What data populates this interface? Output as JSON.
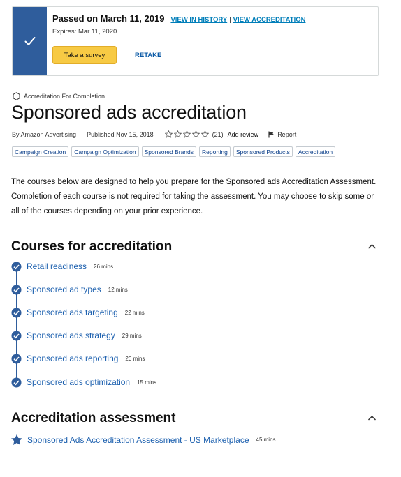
{
  "passed": {
    "title": "Passed on March 11, 2019",
    "view_history": "VIEW IN HISTORY",
    "separator": "|",
    "view_accreditation": "VIEW ACCREDITATION",
    "expires": "Expires: Mar 11, 2020",
    "survey_button": "Take a survey",
    "retake_button": "RETAKE"
  },
  "header": {
    "type_label": "Accreditation For Completion",
    "title": "Sponsored ads accreditation",
    "author": "By Amazon Advertising",
    "published": "Published Nov 15, 2018",
    "rating_count": "(21)",
    "add_review": "Add review",
    "report": "Report"
  },
  "tags": [
    "Campaign Creation",
    "Campaign Optimization",
    "Sponsored Brands",
    "Reporting",
    "Sponsored Products",
    "Accreditation"
  ],
  "description": "The courses below are designed to help you prepare for the Sponsored ads Accreditation Assessment. Completion of each course is not required for taking the assessment. You may choose to skip some or all of the courses depending on your prior experience.",
  "courses_section": {
    "title": "Courses for accreditation",
    "courses": [
      {
        "name": "Retail readiness",
        "duration": "26 mins"
      },
      {
        "name": "Sponsored ad types",
        "duration": "12 mins"
      },
      {
        "name": "Sponsored ads targeting",
        "duration": "22 mins"
      },
      {
        "name": "Sponsored ads strategy",
        "duration": "29 mins"
      },
      {
        "name": "Sponsored ads reporting",
        "duration": "20 mins"
      },
      {
        "name": "Sponsored ads optimization",
        "duration": "15 mins"
      }
    ]
  },
  "assessment_section": {
    "title": "Accreditation assessment",
    "item": {
      "name": "Sponsored Ads Accreditation Assessment - US Marketplace",
      "duration": "45 mins"
    }
  },
  "colors": {
    "check_bar": "#2f5d9c",
    "link": "#007eb9",
    "button": "#f7ca44",
    "course_link": "#1b5fae"
  }
}
